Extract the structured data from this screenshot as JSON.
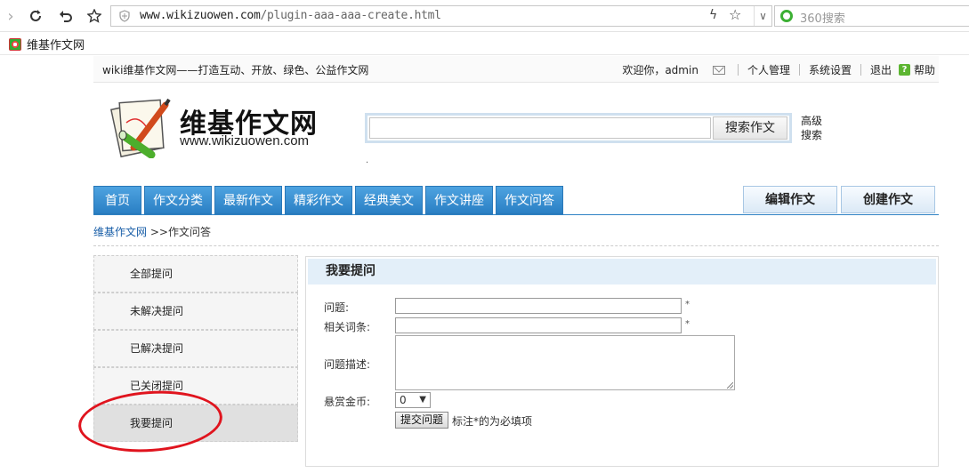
{
  "browser": {
    "url_host": "www.wikizuowen.com",
    "url_path": "/plugin-aaa-aaa-create.html",
    "search_placeholder": "360搜索",
    "bookmark_label": "维基作文网"
  },
  "header": {
    "slogan": "wiki维基作文网——打造互动、开放、绿色、公益作文网",
    "welcome": "欢迎你，admin",
    "personal": "个人管理",
    "settings": "系统设置",
    "logout": "退出",
    "help": "帮助",
    "site_name": "维基作文网",
    "site_url": "www.wikizuowen.com",
    "search_button": "搜索作文",
    "advanced_search": "高级搜索",
    "dot": "."
  },
  "nav": {
    "tabs": [
      "首页",
      "作文分类",
      "最新作文",
      "精彩作文",
      "经典美文",
      "作文讲座",
      "作文问答"
    ],
    "edit": "编辑作文",
    "create": "创建作文"
  },
  "breadcrumb": {
    "home": "维基作文网",
    "current": ">>作文问答"
  },
  "sidebar": {
    "items": [
      "全部提问",
      "未解决提问",
      "已解决提问",
      "已关闭提问",
      "我要提问"
    ]
  },
  "form": {
    "title": "我要提问",
    "question_label": "问题:",
    "entry_label": "相关词条:",
    "desc_label": "问题描述:",
    "reward_label": "悬赏金币:",
    "required_mark": "*",
    "reward_value": "0",
    "submit": "提交问题",
    "note": "标注*的为必填项"
  },
  "colors": {
    "nav_blue": "#2a7fc4",
    "annotation_red": "#e0141e",
    "panel_head": "#e3eff9"
  }
}
